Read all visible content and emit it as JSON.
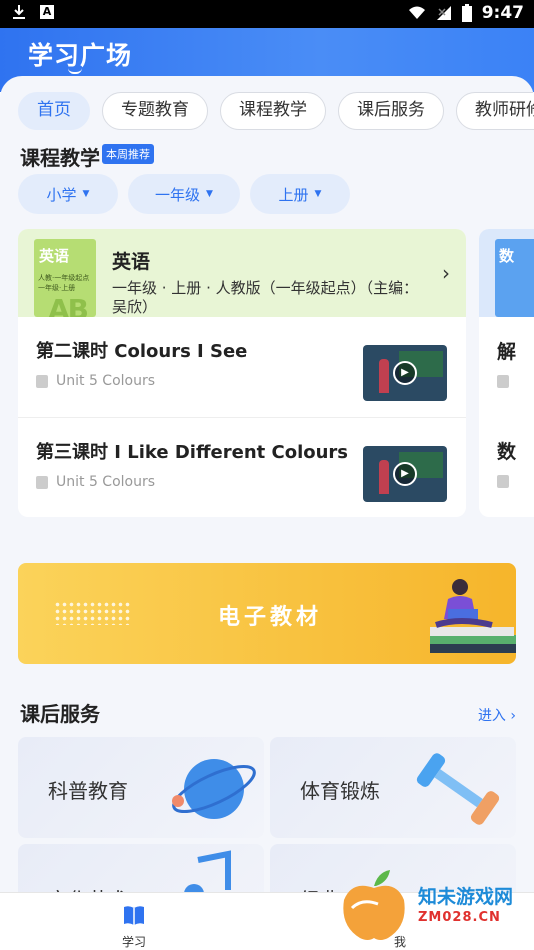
{
  "status_bar": {
    "time": "9:47"
  },
  "header": {
    "title": "学习广场"
  },
  "tabs": [
    {
      "label": "首页",
      "active": true
    },
    {
      "label": "专题教育",
      "active": false
    },
    {
      "label": "课程教学",
      "active": false
    },
    {
      "label": "课后服务",
      "active": false
    },
    {
      "label": "教师研修",
      "active": false
    }
  ],
  "course_section": {
    "title": "课程教学",
    "badge": "本周推荐",
    "filters": [
      "小学",
      "一年级",
      "上册"
    ],
    "card": {
      "book_title": "英语",
      "book_sub1": "人教·一年级起点",
      "book_sub2": "一年级·上册",
      "book_letters": "AB",
      "subject": "英语",
      "info": "一年级 · 上册 · 人教版（一年级起点）（主编：吴欣）",
      "lessons": [
        {
          "title": "第二课时 Colours I See",
          "unit": "Unit 5 Colours"
        },
        {
          "title": "第三课时 I Like Different Colours",
          "unit": "Unit 5 Colours"
        }
      ]
    },
    "card2": {
      "book_title": "数",
      "rows": [
        "解",
        "数"
      ]
    }
  },
  "banner": {
    "text": "电子教材"
  },
  "after_school": {
    "title": "课后服务",
    "more": "进入",
    "items": [
      "科普教育",
      "体育锻炼",
      "文化艺术",
      "经典"
    ]
  },
  "bottom_nav": [
    {
      "label": "学习",
      "icon": "book-icon",
      "active": true
    },
    {
      "label": "我",
      "icon": "user-icon",
      "active": false
    }
  ],
  "watermark": {
    "text": "知未游戏网",
    "url": "ZM028.CN"
  },
  "colors": {
    "primary": "#2f73f0",
    "banner": "#f6b52b",
    "card_head": "#e8f5d5"
  }
}
